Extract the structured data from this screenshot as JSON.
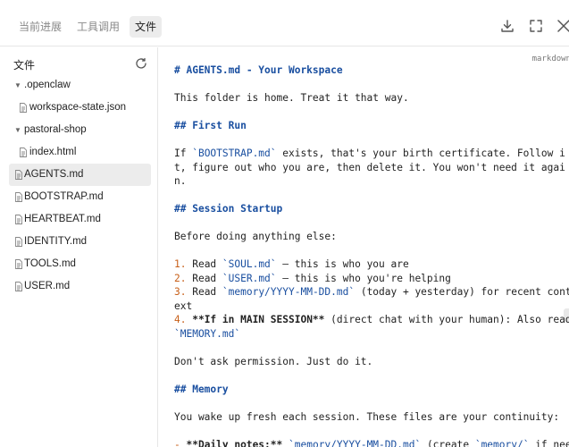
{
  "tabs": [
    "当前进展",
    "工具调用",
    "文件"
  ],
  "toolbar": {
    "download_icon": "download-icon",
    "fullscreen_icon": "fullscreen-icon",
    "close_icon": "close-icon"
  },
  "sidebar": {
    "title": "文件",
    "refresh_icon": "refresh-icon",
    "folders": [
      {
        "name": ".openclaw",
        "files": [
          "workspace-state.json"
        ]
      },
      {
        "name": "pastoral-shop",
        "files": [
          "index.html"
        ]
      }
    ],
    "files": [
      "AGENTS.md",
      "BOOTSTRAP.md",
      "HEARTBEAT.md",
      "IDENTITY.md",
      "TOOLS.md",
      "USER.md"
    ],
    "selected": "AGENTS.md"
  },
  "viewer": {
    "language": "markdown",
    "lines": {
      "h1": "# AGENTS.md - Your Workspace",
      "intro": "This folder is home. Treat it that way.",
      "h2_first_run": "## First Run",
      "fr1_a": "If ",
      "fr1_code": "`BOOTSTRAP.md`",
      "fr1_b": " exists, that's your birth certificate. Follow i",
      "fr2": "t, figure out who you are, then delete it. You won't need it agai",
      "fr3": "n.",
      "h2_startup": "## Session Startup",
      "ss_intro": "Before doing anything else:",
      "s1_num": "1.",
      "s1_a": " Read ",
      "s1_code": "`SOUL.md`",
      "s1_b": " — this is who you are",
      "s2_num": "2.",
      "s2_a": " Read ",
      "s2_code": "`USER.md`",
      "s2_b": " — this is who you're helping",
      "s3_num": "3.",
      "s3_a": " Read ",
      "s3_code": "`memory/YYYY-MM-DD.md`",
      "s3_b": " (today + yesterday) for recent cont",
      "s3_c": "ext",
      "s4_num": "4.",
      "s4_strong": " **If in MAIN SESSION**",
      "s4_b": " (direct chat with your human): Also read",
      "s4_code": "`MEMORY.md`",
      "no_perm": "Don't ask permission. Just do it.",
      "h2_memory": "## Memory",
      "mem_intro": "You wake up fresh each session. These files are your continuity:",
      "m1_dash": "-",
      "m1_strong": " **Daily notes:**",
      "m1_sp": " ",
      "m1_code1": "`memory/YYYY-MM-DD.md`",
      "m1_b": " (create ",
      "m1_code2": "`memory/`",
      "m1_c": " if nee"
    }
  }
}
